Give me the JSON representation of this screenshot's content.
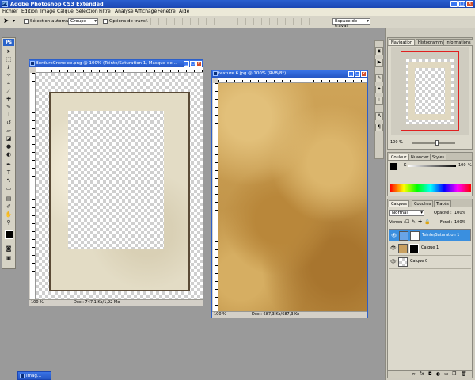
{
  "app": {
    "title": "Adobe Photoshop CS3 Extended",
    "logo_text": "Ps",
    "window_buttons": [
      "_",
      "□",
      "×"
    ]
  },
  "menu": [
    "Fichier",
    "Edition",
    "Image",
    "Calque",
    "Sélection",
    "Filtre",
    "Analyse",
    "Affichage",
    "Fenêtre",
    "Aide"
  ],
  "options_bar": {
    "auto_select_label": "Sélection automatique :",
    "auto_select_value": "Groupe",
    "transform_label": "Options de transf.",
    "workspace_label": "Espace de travail"
  },
  "documents": [
    {
      "title": "BordureCrenelee.png @ 100% (Teinte/Saturation 1, Masque de...",
      "zoom": "100 %",
      "doc_size": "Doc : 747,1 Ko/1,92 Mo"
    },
    {
      "title": "texture 6.jpg @ 100% (RVB/8*)",
      "zoom": "100 %",
      "doc_size": "Doc : 687,3 Ko/687,3 Ko"
    }
  ],
  "minimized_doc": {
    "label": "Imag..."
  },
  "navigator": {
    "tabs": [
      "Navigation",
      "Histogramme",
      "Informations"
    ],
    "zoom": "100 %"
  },
  "color_panel": {
    "tabs": [
      "Couleur",
      "Nuancier",
      "Styles"
    ],
    "slider_label": "K",
    "slider_value": "100",
    "unit": "%"
  },
  "layers_panel": {
    "tabs": [
      "Calques",
      "Couches",
      "Tracés"
    ],
    "blend_mode": "Normal",
    "opacity_label": "Opacité :",
    "opacity_value": "100%",
    "lock_label": "Verrou :",
    "fill_label": "Fond :",
    "fill_value": "100%",
    "layers": [
      {
        "name": "Teinte/Saturation 1",
        "selected": true
      },
      {
        "name": "Calque 1",
        "selected": false
      },
      {
        "name": "Calque 0",
        "selected": false
      }
    ]
  },
  "colors": {
    "selection_blue": "#3a8fdf",
    "titlebar_blue": "#2556c4",
    "close_red": "#d5502a"
  }
}
